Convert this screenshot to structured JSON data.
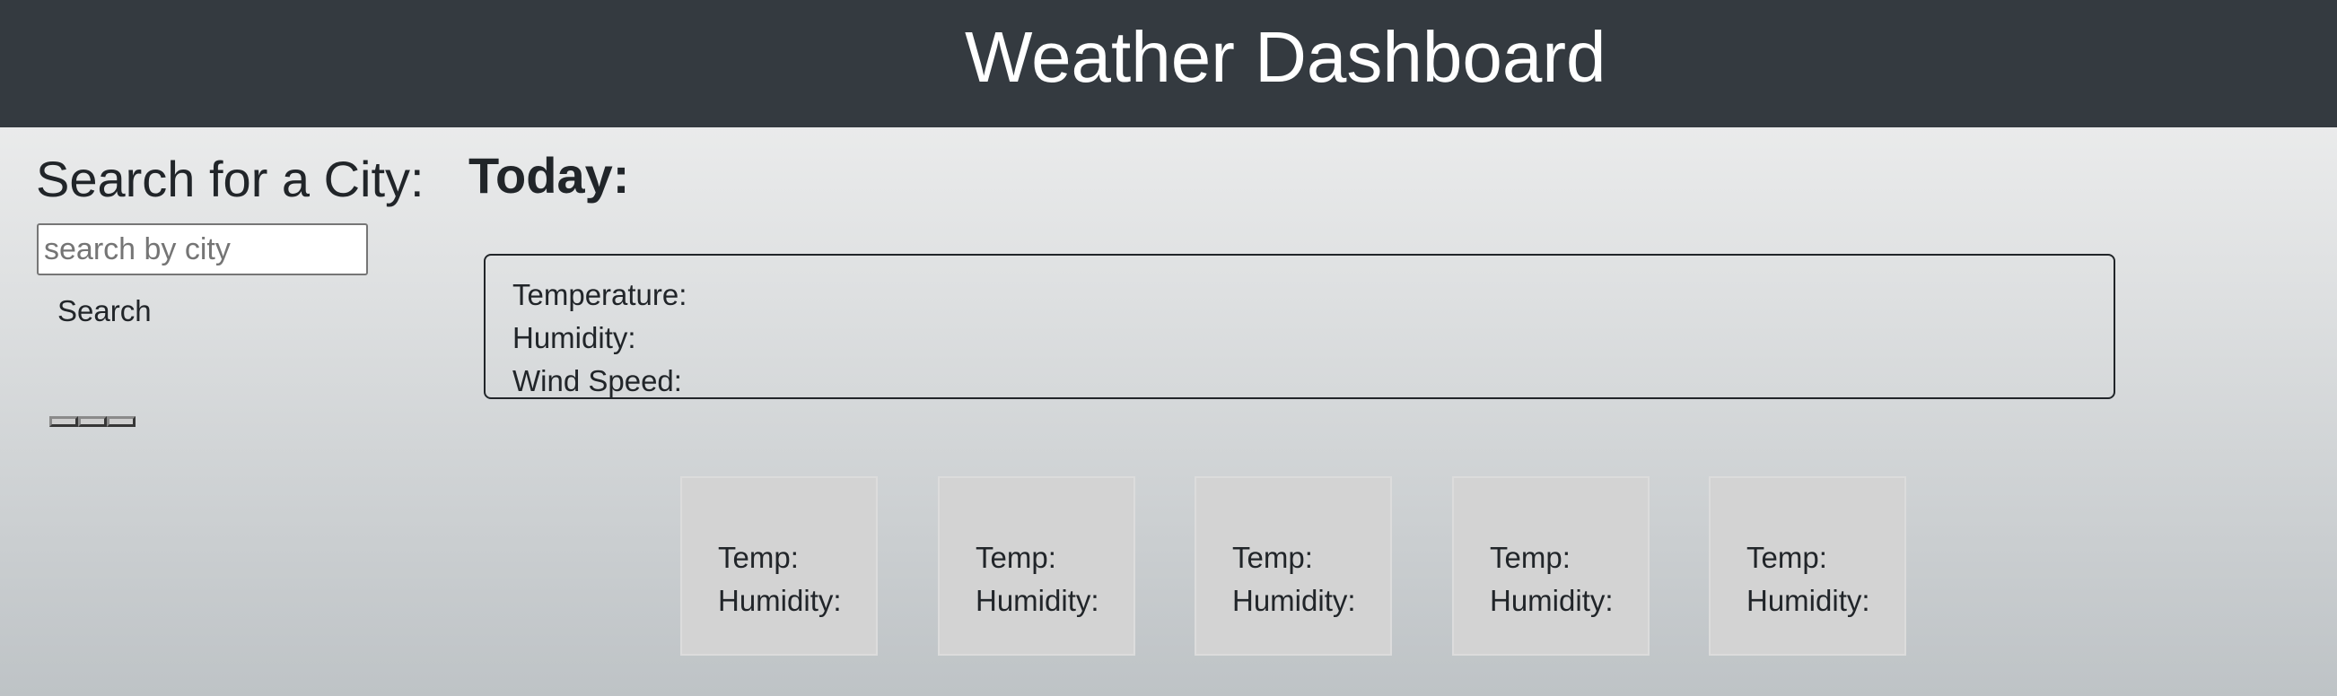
{
  "header": {
    "title": "Weather Dashboard"
  },
  "sidebar": {
    "heading": "Search for a City:",
    "search_placeholder": "search by city",
    "search_value": "",
    "search_button_label": "Search",
    "history_items": [
      "",
      "",
      ""
    ]
  },
  "today": {
    "heading": "Today:",
    "temperature_label": "Temperature:",
    "humidity_label": "Humidity:",
    "wind_speed_label": "Wind Speed:"
  },
  "forecast": [
    {
      "temp_label": "Temp:",
      "humidity_label": "Humidity:"
    },
    {
      "temp_label": "Temp:",
      "humidity_label": "Humidity:"
    },
    {
      "temp_label": "Temp:",
      "humidity_label": "Humidity:"
    },
    {
      "temp_label": "Temp:",
      "humidity_label": "Humidity:"
    },
    {
      "temp_label": "Temp:",
      "humidity_label": "Humidity:"
    }
  ],
  "colors": {
    "header_background": "#343a40",
    "header_text": "#ffffff",
    "forecast_card_background": "#d3d3d3",
    "text": "#212529"
  }
}
